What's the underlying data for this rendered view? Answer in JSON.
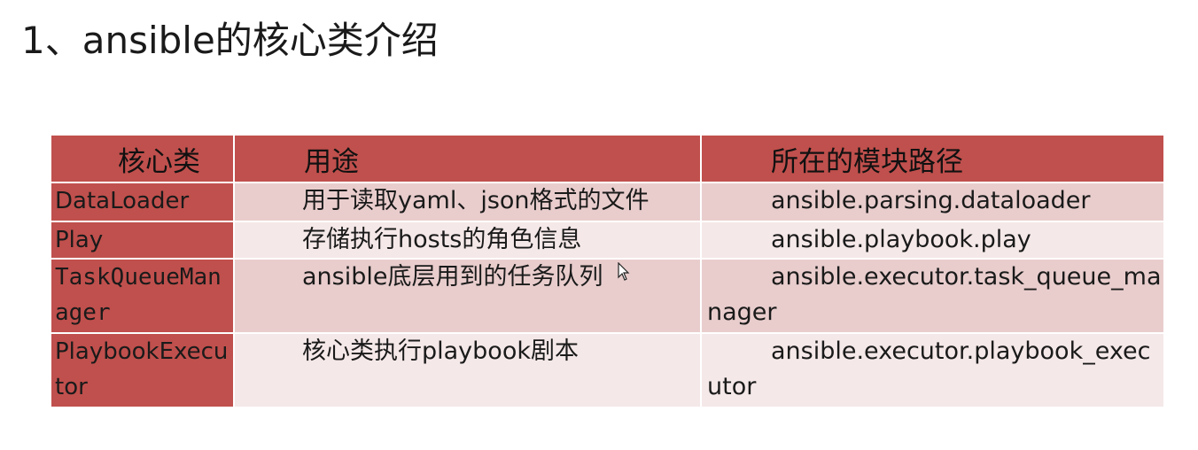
{
  "title": "1、ansible的核心类介绍",
  "table": {
    "headers": [
      "核心类",
      "用途",
      "所在的模块路径"
    ],
    "rows": [
      {
        "class": "DataLoader",
        "usage": "用于读取yaml、json格式的文件",
        "path": "ansible.parsing.dataloader"
      },
      {
        "class": "Play",
        "usage": "存储执行hosts的角色信息",
        "path": "ansible.playbook.play"
      },
      {
        "class": "TaskQueueManager",
        "usage": "ansible底层用到的任务队列",
        "path": "ansible.executor.task_queue_manager"
      },
      {
        "class": "PlaybookExecutor",
        "usage": "核心类执行playbook剧本",
        "path": "ansible.executor.playbook_executor"
      }
    ]
  },
  "colors": {
    "header_bg": "#c0504d",
    "row_odd_bg": "#e9cdcd",
    "row_even_bg": "#f5e8e8"
  }
}
